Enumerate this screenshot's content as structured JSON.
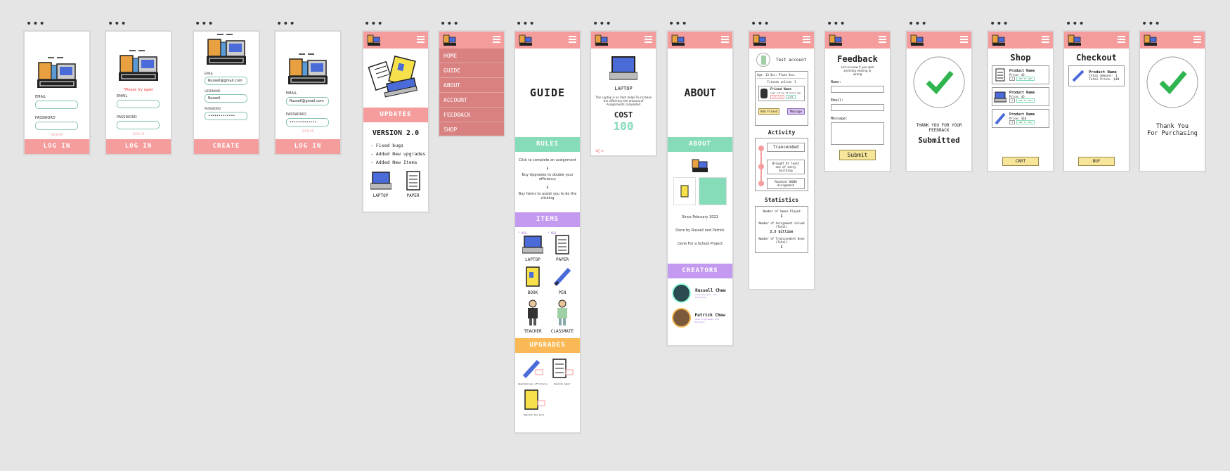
{
  "colors": {
    "header": "#f59d9d",
    "mint": "#86dcb8",
    "purple": "#c49af0",
    "orange": "#fbb956",
    "green": "#2fb54f",
    "cost": "#86dcb8"
  },
  "login": {
    "email_label": "EMAIL",
    "password_label": "PASSWORD",
    "signup": "SIGN UP",
    "button": "LOG IN",
    "email_value": "Russell@gmail.com",
    "password_value": "•••••••••••••",
    "error": "*Please try again"
  },
  "create": {
    "email_label": "EMAIL",
    "username_label": "USERNAME",
    "password_label": "PASSWORD",
    "email_value": "Russell@gmail.com",
    "username_value": "Russell",
    "password_value": "•••••••••••••",
    "button": "CREATE"
  },
  "updates": {
    "bar": "UPDATES",
    "version": "VERSION 2.0",
    "items": [
      "- Fixed bugs",
      "- Added New upgrades",
      "- Added New Items"
    ],
    "icons": [
      "LAPTOP",
      "PAPER"
    ]
  },
  "menu": {
    "items": [
      "HOME",
      "GUIDE",
      "ABOUT",
      "ACCOUNT",
      "FEEDBACK",
      "SHOP"
    ]
  },
  "guide": {
    "title": "GUIDE",
    "rules_bar": "RULES",
    "rules": [
      "Click to complete an assignment",
      "Buy Upgrades to double your efficiency",
      "Buy Items to assist you to do the clicking"
    ],
    "items_bar": "ITEMS",
    "new": "* NEW",
    "items": [
      "LAPTOP",
      "PAPER",
      "BOOK",
      "PEN",
      "TEACHER",
      "CLASSMATE"
    ],
    "upgrades_bar": "UPGRADES",
    "upgrade_labels": [
      "Upgraded pen efficiency",
      "Upgrade paper",
      "Upgrade the book"
    ]
  },
  "laptop": {
    "back": "<-",
    "name": "LAPTOP",
    "desc": "This Laptop is an item helps To increase the efficiency the amount of Assignments completed",
    "cost_label": "COST",
    "cost": "100"
  },
  "about": {
    "title": "ABOUT",
    "bar": "ABOUT",
    "lines": [
      "Since February 2021",
      "Done by Russell and Patrick",
      "Done For a School Project"
    ],
    "creators_bar": "CREATORS",
    "creators": [
      {
        "name": "Russell Chew",
        "role": "Lead Designer and Developer"
      },
      {
        "name": "Patrick Chew",
        "role": "Lead Programmer and Designer"
      }
    ]
  },
  "account": {
    "name": "Test account",
    "age": "Age: 13",
    "class": "Sec: Pluto",
    "sec": "Sec:",
    "friends": "Friends online: 1",
    "friend_name": "Friend Name",
    "friend_status": "Last online 10 hours ago",
    "friend_btn1": "Unfriend",
    "friend_btn2": "Gift",
    "add_friend": "Add Friend",
    "message": "Message",
    "activity_title": "Activity",
    "activity": [
      "Trancended",
      "Brought At least one of every building",
      "Reached 10000 Assignment"
    ],
    "stats_title": "Statistics",
    "stats": [
      {
        "label": "Number of Games Played",
        "value": "1"
      },
      {
        "label": "Number of Assignment solved (Total)",
        "value": "2.5 billion"
      },
      {
        "label": "Number of Transcendent Done (Total)",
        "value": "1"
      }
    ]
  },
  "feedback": {
    "title": "Feedback",
    "subtitle": "Let us know if you spot anything missing or wrong",
    "name": "Name:",
    "email": "Email:",
    "message": "Message:",
    "submit": "Submit"
  },
  "submitted": {
    "thanks": "THANK YOU FOR YOUR FEEDBACK",
    "status": "Submitted"
  },
  "shop": {
    "title": "Shop",
    "products": [
      {
        "name": "Product Name",
        "price": "Price: $5",
        "qty": "1",
        "btn": "ADD TO CART"
      },
      {
        "name": "Product Name",
        "price": "Price: $5",
        "qty": "1",
        "btn": "ADD TO CART"
      },
      {
        "name": "Product Name",
        "price": "Price: $10",
        "qty": "1",
        "btn": "ADD TO CART"
      }
    ],
    "cart": "CART"
  },
  "checkout": {
    "title": "Checkout",
    "product": "Product Name",
    "amount": "Total Amount: 1",
    "price": "Total Price: $10",
    "buy": "BUY"
  },
  "purchased": {
    "line1": "Thank You",
    "line2": "For Purchasing"
  }
}
